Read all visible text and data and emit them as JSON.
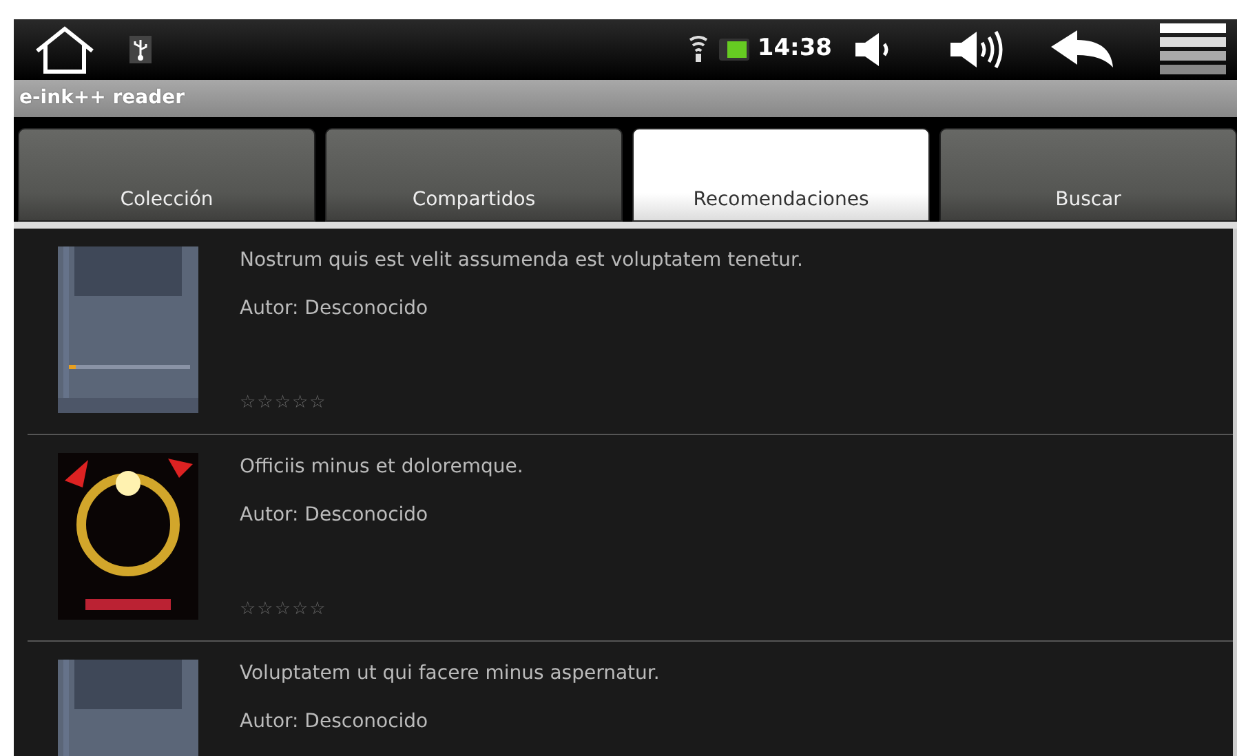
{
  "status_bar": {
    "time": "14:38"
  },
  "app_title": "e-ink++ reader",
  "tabs": [
    {
      "label": "Colección",
      "selected": false
    },
    {
      "label": "Compartidos",
      "selected": false
    },
    {
      "label": "Recomendaciones",
      "selected": true
    },
    {
      "label": "Buscar",
      "selected": false
    }
  ],
  "books": [
    {
      "title": "Nostrum quis est velit assumenda est voluptatem tenetur.",
      "author": "Autor: Desconocido",
      "stars": 0
    },
    {
      "title": "Officiis minus et doloremque.",
      "author": "Autor: Desconocido",
      "stars": 0
    },
    {
      "title": "Voluptatem ut qui facere minus aspernatur.",
      "author": "Autor: Desconocido"
    }
  ]
}
